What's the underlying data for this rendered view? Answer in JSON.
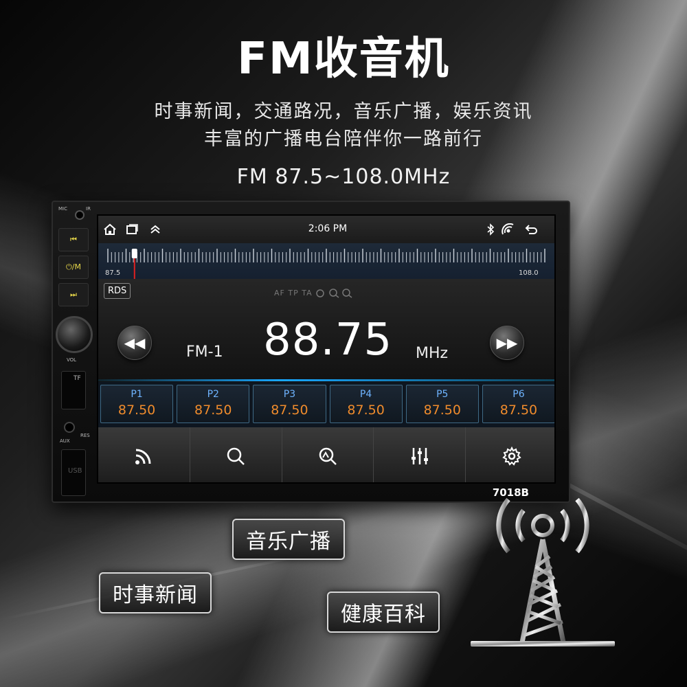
{
  "hero": {
    "title": "FM收音机",
    "desc_line1": "时事新闻，交通路况，音乐广播，娱乐资讯",
    "desc_line2": "丰富的广播电台陪伴你一路前行",
    "freq_range": "FM 87.5~108.0MHz"
  },
  "device": {
    "model": "7018B",
    "side_labels": {
      "mic": "MIC",
      "ir": "IR",
      "vol": "VOL",
      "tf": "TF",
      "aux": "AUX",
      "res": "RES",
      "usb": "USB"
    },
    "side_buttons": [
      "⏮",
      "⏻/M",
      "⏭"
    ]
  },
  "status": {
    "time": "2:06 PM",
    "icons": [
      "home-icon",
      "recent-apps-icon",
      "expand-up-icon",
      "bluetooth-icon",
      "radio-signal-icon",
      "back-icon"
    ]
  },
  "tuner": {
    "min_label": "87.5",
    "max_label": "108.0",
    "min": 87.5,
    "max": 108.0,
    "current": 88.75
  },
  "radio": {
    "rds_label": "RDS",
    "flags": "AF  TP  TA",
    "band": "FM-1",
    "frequency": "88.75",
    "unit": "MHz"
  },
  "presets": [
    {
      "name": "P1",
      "freq": "87.50"
    },
    {
      "name": "P2",
      "freq": "87.50"
    },
    {
      "name": "P3",
      "freq": "87.50"
    },
    {
      "name": "P4",
      "freq": "87.50"
    },
    {
      "name": "P5",
      "freq": "87.50"
    },
    {
      "name": "P6",
      "freq": "87.50"
    }
  ],
  "toolbar": {
    "icons": [
      "radio-wave-icon",
      "search-icon",
      "scan-icon",
      "equalizer-icon",
      "settings-icon"
    ]
  },
  "tags": {
    "music": "音乐广播",
    "news": "时事新闻",
    "health": "健康百科"
  },
  "colors": {
    "preset_name": "#6fb4ff",
    "preset_freq": "#ef8b2c",
    "accent": "#19a7ff",
    "tuner_needle": "#e02020"
  }
}
